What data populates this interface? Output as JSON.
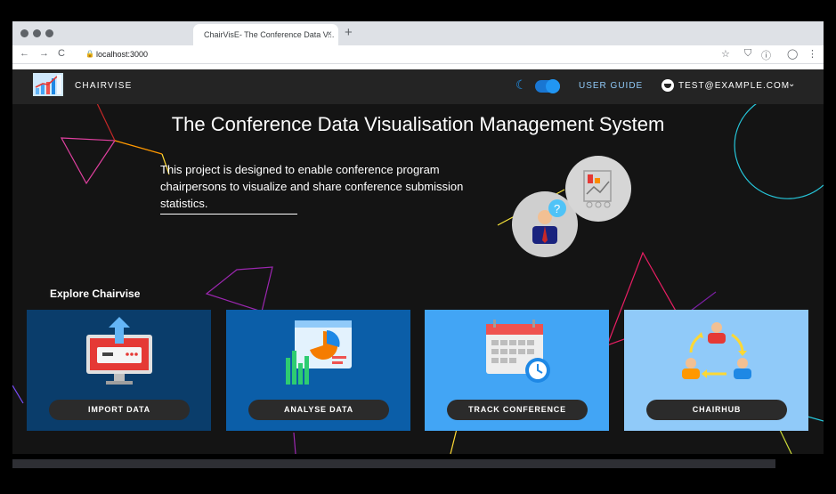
{
  "browser": {
    "tab_title": "ChairVisE- The Conference Data V...",
    "tab_close": "×",
    "new_tab": "+",
    "back": "←",
    "forward": "→",
    "reload": "C",
    "lock": "🔒",
    "url": "localhost:3000",
    "star": "☆",
    "pocket": "⛉",
    "info": "ⓘ",
    "profile": "◯",
    "menu": "⋮"
  },
  "appbar": {
    "brand": "CHAIRVISE",
    "theme_icon": "☾",
    "user_guide": "USER GUIDE",
    "user_email": "TEST@EXAMPLE.COM",
    "user_chevron": "⌄"
  },
  "hero": {
    "title": "The Conference Data Visualisation Management System",
    "description": "This project is designed to enable conference program chairpersons to visualize and share conference submission statistics."
  },
  "explore": {
    "heading": "Explore Chairvise",
    "cards": [
      {
        "label": "IMPORT DATA",
        "bg": "#0a3d6b",
        "icon": "computer-upload-icon"
      },
      {
        "label": "ANALYSE DATA",
        "bg": "#0b5ea8",
        "icon": "analytics-chart-icon"
      },
      {
        "label": "TRACK CONFERENCE",
        "bg": "#42a5f5",
        "icon": "calendar-clock-icon"
      },
      {
        "label": "CHAIRHUB",
        "bg": "#90caf9",
        "icon": "people-cycle-icon"
      }
    ]
  },
  "colors": {
    "accent": "#2196f3",
    "appbar": "#242424",
    "background": "#141414"
  }
}
